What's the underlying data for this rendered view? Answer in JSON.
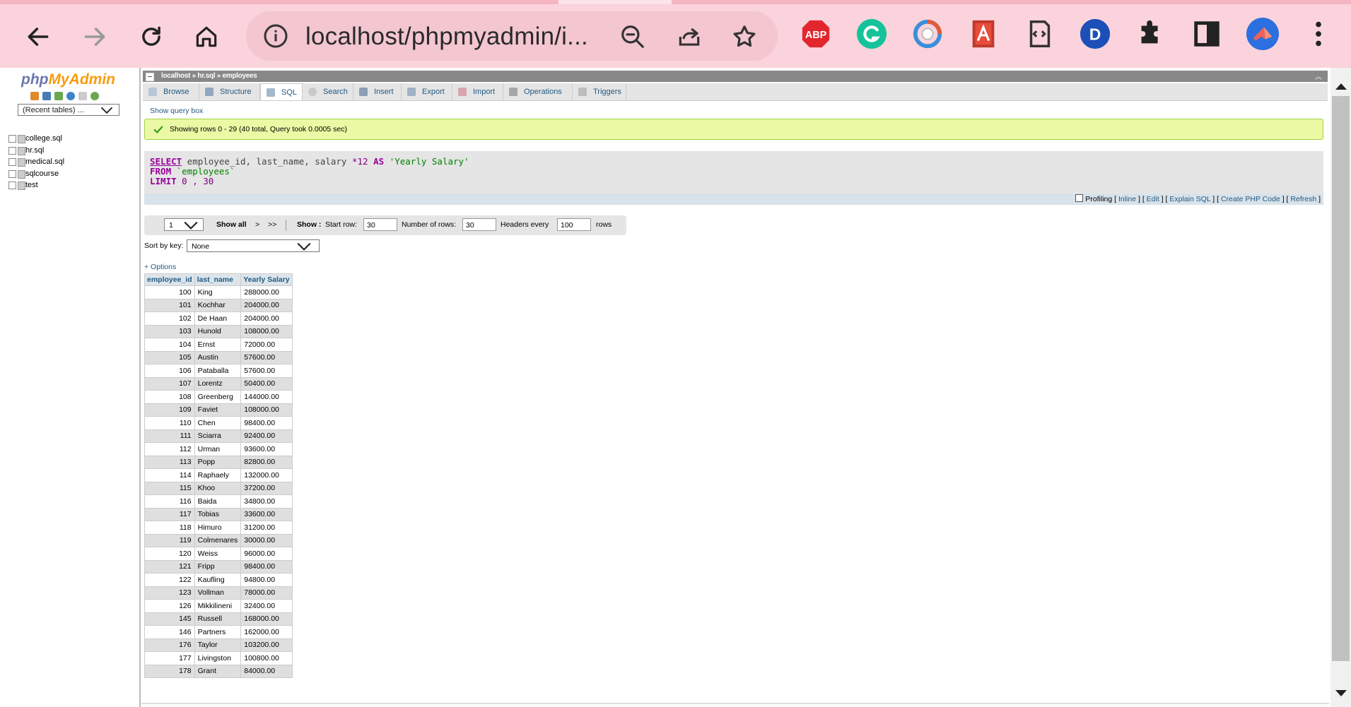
{
  "browser": {
    "url": "localhost/phpmyadmin/i...",
    "nav": [
      "back-icon",
      "forward-icon",
      "reload-icon",
      "home-icon"
    ],
    "extensions": [
      {
        "name": "adblock-plus-icon",
        "label": "ABP",
        "color": "#e3262e"
      },
      {
        "name": "grammarly-icon",
        "label": "G",
        "color": "#15c39a"
      },
      {
        "name": "sync-icon",
        "label": "",
        "color": "#3b8fd9"
      },
      {
        "name": "pdf-icon",
        "label": "",
        "color": "#d93025"
      },
      {
        "name": "script-icon",
        "label": "",
        "color": "#333333"
      },
      {
        "name": "dashlane-icon",
        "label": "D",
        "color": "#1d4fb8"
      },
      {
        "name": "puzzle-icon",
        "label": "",
        "color": "#222222"
      },
      {
        "name": "sidepanel-icon",
        "label": "",
        "color": "#222222"
      },
      {
        "name": "profile-avatar-icon",
        "label": "",
        "color": "#2b6fe0"
      },
      {
        "name": "menu-icon",
        "label": "",
        "color": "#222222"
      }
    ]
  },
  "sidebar": {
    "logo_php": "php",
    "logo_myadmin": "MyAdmin",
    "recent_tables": "(Recent tables) ...",
    "databases": [
      "college.sql",
      "hr.sql",
      "medical.sql",
      "sqlcourse",
      "test"
    ]
  },
  "breadcrumb": {
    "server": "localhost",
    "database": "hr.sql",
    "table": "employees"
  },
  "tabs": [
    {
      "id": "browse",
      "label": "Browse",
      "active": false
    },
    {
      "id": "structure",
      "label": "Structure",
      "active": false
    },
    {
      "id": "sql",
      "label": "SQL",
      "active": true
    },
    {
      "id": "search",
      "label": "Search",
      "active": false
    },
    {
      "id": "insert",
      "label": "Insert",
      "active": false
    },
    {
      "id": "export",
      "label": "Export",
      "active": false
    },
    {
      "id": "import",
      "label": "Import",
      "active": false
    },
    {
      "id": "operations",
      "label": "Operations",
      "active": false
    },
    {
      "id": "triggers",
      "label": "Triggers",
      "active": false
    }
  ],
  "show_query_box": "Show query box",
  "success_message": "Showing rows 0 - 29 (40 total, Query took 0.0005 sec)",
  "query": {
    "line1_kw": "SELECT",
    "line1_rest": " employee_id, last_name, salary ",
    "line1_op": "*12",
    "line1_as": "AS",
    "line1_str": "'Yearly Salary'",
    "line2_kw": "FROM",
    "line2_rest": " `employees`",
    "line3_kw": "LIMIT",
    "line3_rest": " 0 , 30"
  },
  "query_links": {
    "profiling": "Profiling",
    "inline": "Inline",
    "edit": "Edit",
    "explain": "Explain SQL",
    "create_php": "Create PHP Code",
    "refresh": "Refresh"
  },
  "navigation": {
    "page": "1",
    "show_all": "Show all",
    "next": ">",
    "last": ">>",
    "show_label": "Show :",
    "start_row_label": "Start row:",
    "start_row": "30",
    "num_rows_label": "Number of rows:",
    "num_rows": "30",
    "headers_every_label": "Headers every",
    "headers_every": "100",
    "rows_label": "rows"
  },
  "sort": {
    "label": "Sort by key:",
    "value": "None"
  },
  "options_link": "+ Options",
  "table": {
    "columns": [
      "employee_id",
      "last_name",
      "Yearly Salary"
    ],
    "rows": [
      [
        "100",
        "King",
        "288000.00"
      ],
      [
        "101",
        "Kochhar",
        "204000.00"
      ],
      [
        "102",
        "De Haan",
        "204000.00"
      ],
      [
        "103",
        "Hunold",
        "108000.00"
      ],
      [
        "104",
        "Ernst",
        "72000.00"
      ],
      [
        "105",
        "Austin",
        "57600.00"
      ],
      [
        "106",
        "Pataballa",
        "57600.00"
      ],
      [
        "107",
        "Lorentz",
        "50400.00"
      ],
      [
        "108",
        "Greenberg",
        "144000.00"
      ],
      [
        "109",
        "Faviet",
        "108000.00"
      ],
      [
        "110",
        "Chen",
        "98400.00"
      ],
      [
        "111",
        "Sciarra",
        "92400.00"
      ],
      [
        "112",
        "Urman",
        "93600.00"
      ],
      [
        "113",
        "Popp",
        "82800.00"
      ],
      [
        "114",
        "Raphaely",
        "132000.00"
      ],
      [
        "115",
        "Khoo",
        "37200.00"
      ],
      [
        "116",
        "Baida",
        "34800.00"
      ],
      [
        "117",
        "Tobias",
        "33600.00"
      ],
      [
        "118",
        "Himuro",
        "31200.00"
      ],
      [
        "119",
        "Colmenares",
        "30000.00"
      ],
      [
        "120",
        "Weiss",
        "96000.00"
      ],
      [
        "121",
        "Fripp",
        "98400.00"
      ],
      [
        "122",
        "Kaufling",
        "94800.00"
      ],
      [
        "123",
        "Vollman",
        "78000.00"
      ],
      [
        "126",
        "Mikkilineni",
        "32400.00"
      ],
      [
        "145",
        "Russell",
        "168000.00"
      ],
      [
        "146",
        "Partners",
        "162000.00"
      ],
      [
        "176",
        "Taylor",
        "103200.00"
      ],
      [
        "177",
        "Livingston",
        "100800.00"
      ],
      [
        "178",
        "Grant",
        "84000.00"
      ]
    ]
  }
}
